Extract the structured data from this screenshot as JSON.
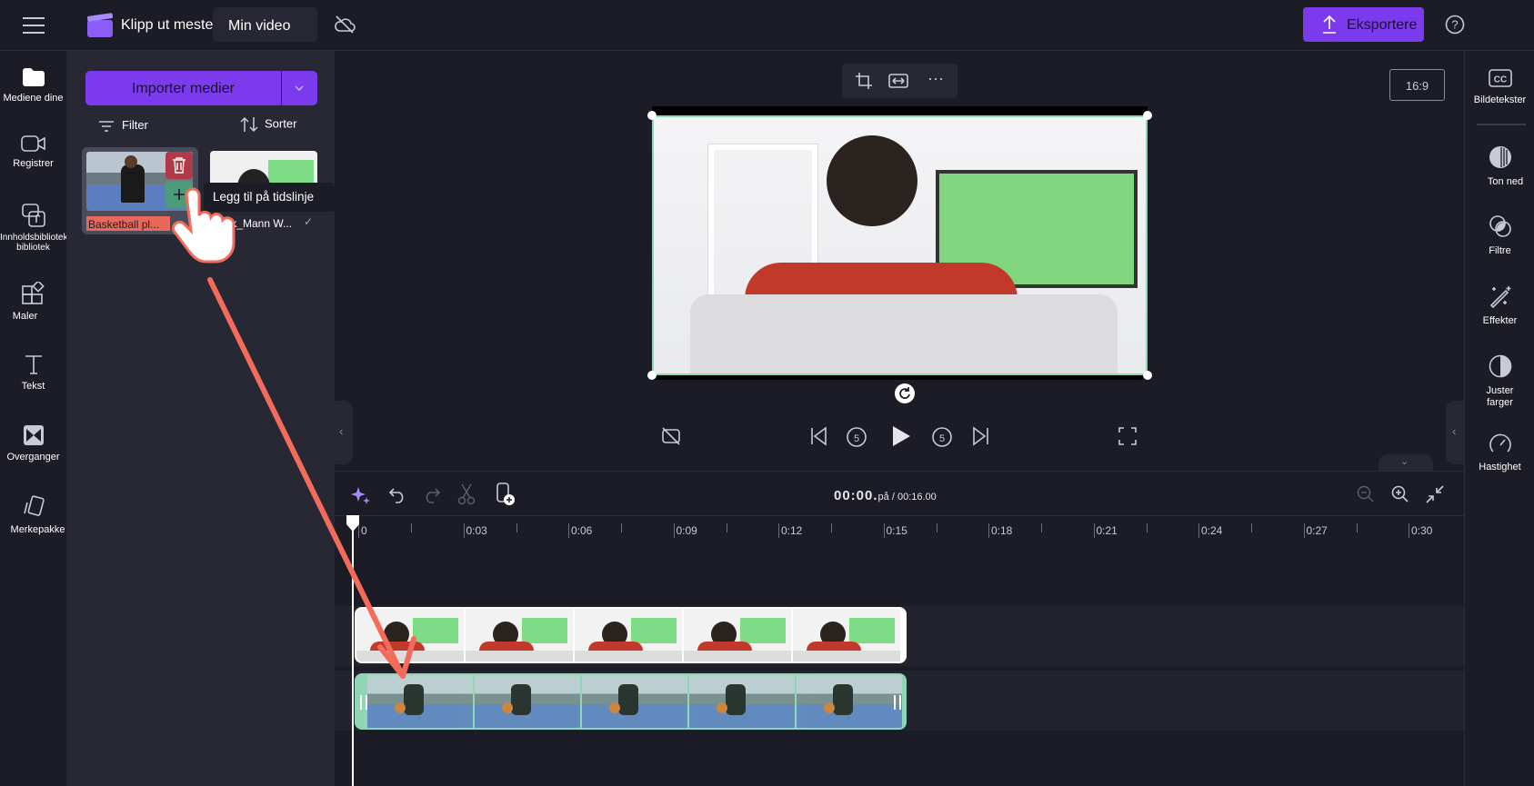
{
  "topbar": {
    "menu_icon": "hamburger-icon",
    "app_name": "Klipp ut mester",
    "project_title": "Min video",
    "cloud_icon": "cloud-off-icon",
    "export_label": "Eksportere",
    "help_icon": "help-icon"
  },
  "rail": {
    "items": [
      {
        "label": "Mediene dine",
        "icon": "folder-icon"
      },
      {
        "label": "Registrer",
        "icon": "camera-icon"
      },
      {
        "label": "Innholdsbibliotek bibliotek",
        "icon": "content-library-icon"
      },
      {
        "label": "Maler",
        "icon": "templates-icon"
      },
      {
        "label": "Tekst",
        "icon": "text-icon"
      },
      {
        "label": "Overganger",
        "icon": "transitions-icon"
      },
      {
        "label": "Merkepakke",
        "icon": "brand-kit-icon"
      }
    ]
  },
  "media": {
    "import_label": "Importer medier",
    "filter_label": "Filter",
    "sort_label": "Sorter",
    "items": [
      {
        "name": "Basketball pl..."
      },
      {
        "name": "Møkk_",
        "name2": "Mann W..."
      }
    ],
    "tooltip": "Legg til på tidslinje"
  },
  "preview": {
    "aspect": "16:9"
  },
  "right_rail": {
    "items": [
      {
        "label": "Bildetekster",
        "icon": "captions-icon"
      },
      {
        "label": "Ton ned",
        "icon": "fade-icon"
      },
      {
        "label": "Filtre",
        "icon": "filters-icon"
      },
      {
        "label": "Effekter",
        "icon": "effects-icon"
      },
      {
        "label": "Juster farger",
        "icon": "adjust-colors-icon"
      },
      {
        "label": "Hastighet",
        "icon": "speed-icon"
      }
    ]
  },
  "timeline": {
    "current": "00:00.",
    "separator": "på / ",
    "total": "00:16.00",
    "ruler": [
      "0",
      "0:03",
      "0:06",
      "0:09",
      "0:12",
      "0:15",
      "0:18",
      "0:21",
      "0:24",
      "0:27",
      "0:30"
    ]
  },
  "colors": {
    "accent": "#7c3aed",
    "annotation": "#f26b5b",
    "clip_selected": "#8fd6b4"
  }
}
